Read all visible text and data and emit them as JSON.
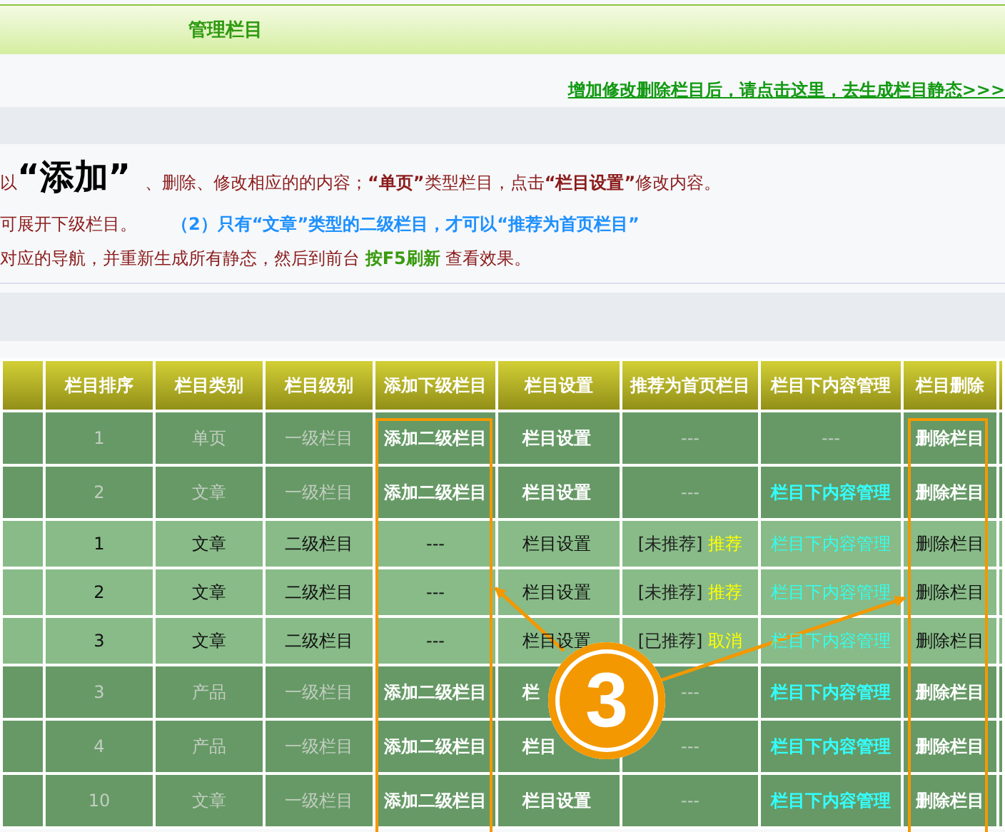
{
  "header": {
    "title": "管理栏目"
  },
  "regen_link": "增加修改删除栏目后，请点击这里，去生成栏目静态>>>",
  "instructions": [
    {
      "segments": [
        {
          "kind": "normal",
          "text": "以"
        },
        {
          "kind": "big",
          "text": "“添加”"
        },
        {
          "kind": "normal",
          "text": "、删除、修改相应的的内容；"
        },
        {
          "kind": "bold",
          "text": "“单页”"
        },
        {
          "kind": "normal",
          "text": "类型栏目，点击"
        },
        {
          "kind": "bold",
          "text": "“栏目设置”"
        },
        {
          "kind": "normal",
          "text": "修改内容。"
        }
      ]
    },
    {
      "segments": [
        {
          "kind": "normal",
          "text": "可展开下级栏目。"
        },
        {
          "kind": "blue",
          "text": "（2）只有“文章”类型的二级栏目，才可以“推荐为首页栏目”"
        }
      ]
    },
    {
      "segments": [
        {
          "kind": "normal",
          "text": "对应的导航，并重新生成所有静态，然后到前台 "
        },
        {
          "kind": "green",
          "text": "按F5刷新"
        },
        {
          "kind": "normal",
          "text": " 查看效果。"
        }
      ]
    }
  ],
  "table": {
    "columns": [
      "栏目排序",
      "栏目类别",
      "栏目级别",
      "添加下级栏目",
      "栏目设置",
      "推荐为首页栏目",
      "栏目下内容管理",
      "栏目删除"
    ],
    "rows": [
      {
        "kind": "parent",
        "order": "1",
        "type": "单页",
        "level": "一级栏目",
        "add": "添加二级栏目",
        "settings": "栏目设置",
        "recommend": "---",
        "content": "---",
        "delete": "删除栏目"
      },
      {
        "kind": "parent",
        "order": "2",
        "type": "文章",
        "level": "一级栏目",
        "add": "添加二级栏目",
        "settings": "栏目设置",
        "recommend": "---",
        "content": "栏目下内容管理",
        "delete": "删除栏目"
      },
      {
        "kind": "child",
        "order": "1",
        "type": "文章",
        "level": "二级栏目",
        "add": "---",
        "settings": "栏目设置",
        "recommend": "[未推荐]",
        "recommend_action": "推荐",
        "content": "栏目下内容管理",
        "delete": "删除栏目"
      },
      {
        "kind": "child",
        "order": "2",
        "type": "文章",
        "level": "二级栏目",
        "add": "---",
        "settings": "栏目设置",
        "recommend": "[未推荐]",
        "recommend_action": "推荐",
        "content": "栏目下内容管理",
        "delete": "删除栏目"
      },
      {
        "kind": "child",
        "order": "3",
        "type": "文章",
        "level": "二级栏目",
        "add": "---",
        "settings": "栏目设置",
        "recommend": "[已推荐]",
        "recommend_action": "取消",
        "content": "栏目下内容管理",
        "delete": "删除栏目"
      },
      {
        "kind": "parent",
        "order": "3",
        "type": "产品",
        "level": "一级栏目",
        "add": "添加二级栏目",
        "settings": "栏",
        "recommend": "---",
        "content": "栏目下内容管理",
        "delete": "删除栏目"
      },
      {
        "kind": "parent",
        "order": "4",
        "type": "产品",
        "level": "一级栏目",
        "add": "添加二级栏目",
        "settings": "栏目",
        "recommend": "---",
        "content": "栏目下内容管理",
        "delete": "删除栏目"
      },
      {
        "kind": "parent",
        "order": "10",
        "type": "文章",
        "level": "一级栏目",
        "add": "添加二级栏目",
        "settings": "栏目设置",
        "recommend": "---",
        "content": "栏目下内容管理",
        "delete": "删除栏目"
      }
    ]
  },
  "callout": {
    "label": "3"
  }
}
